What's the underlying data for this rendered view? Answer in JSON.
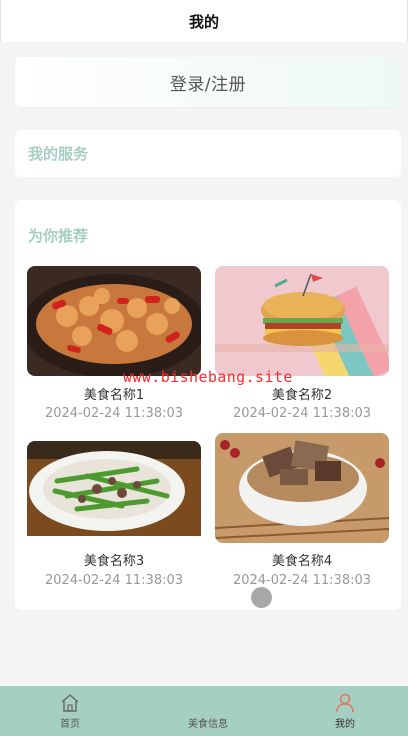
{
  "header": {
    "title": "我的"
  },
  "login": {
    "label": "登录/注册"
  },
  "services": {
    "title": "我的服务"
  },
  "recommend": {
    "title": "为你推荐",
    "items": [
      {
        "name": "美食名称1",
        "date": "2024-02-24 11:38:03",
        "image": "spicy-chicken-dish"
      },
      {
        "name": "美食名称2",
        "date": "2024-02-24 11:38:03",
        "image": "burger"
      },
      {
        "name": "美食名称3",
        "date": "2024-02-24 11:38:03",
        "image": "green-bean-stir-fry"
      },
      {
        "name": "美食名称4",
        "date": "2024-02-24 11:38:03",
        "image": "braised-meat-bowl"
      }
    ]
  },
  "watermark": "www.bishebang.site",
  "tabbar": {
    "items": [
      {
        "label": "首页",
        "icon": "home-icon"
      },
      {
        "label": "美食信息",
        "icon": "none"
      },
      {
        "label": "我的",
        "icon": "user-icon",
        "active": true
      }
    ]
  },
  "colors": {
    "accent": "#a6cfc3",
    "active_tab_icon": "#e07a5f"
  }
}
